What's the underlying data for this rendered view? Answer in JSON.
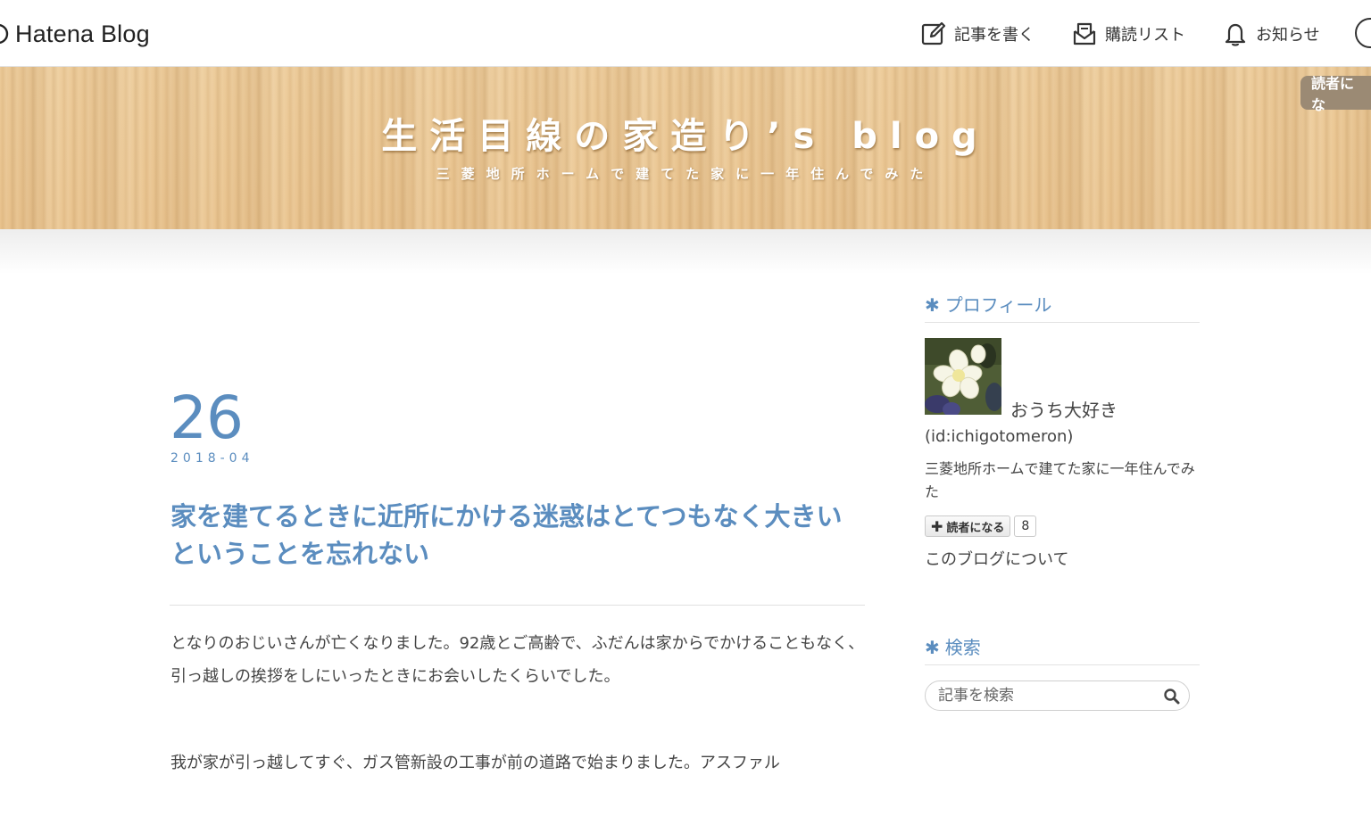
{
  "topbar": {
    "brand": "Hatena Blog",
    "nav": [
      {
        "label": "記事を書く",
        "icon": "pencil-square-icon"
      },
      {
        "label": "購読リスト",
        "icon": "mail-tray-icon"
      },
      {
        "label": "お知らせ",
        "icon": "bell-icon"
      }
    ],
    "avatar_icon": "user-avatar-icon"
  },
  "header": {
    "title": "生活目線の家造り’s blog",
    "description": "三菱地所ホームで建てた家に一年住んでみた",
    "reader_button": "読者にな"
  },
  "entry": {
    "day": "26",
    "year_month": "2018-04",
    "title": "家を建てるときに近所にかける迷惑はとてつもなく大きいということを忘れない",
    "paragraphs": [
      "となりのおじいさんが亡くなりました。92歳とご高齢で、ふだんは家からでかけることもなく、引っ越しの挨拶をしにいったときにお会いしたくらいでした。",
      "我が家が引っ越してすぐ、ガス管新設の工事が前の道路で始まりました。アスファル"
    ]
  },
  "sidebar": {
    "profile_heading": "プロフィール",
    "nickname": "おうち大好き",
    "user_id": "(id:ichigotomeron)",
    "description": "三菱地所ホームで建てた家に一年住んでみた",
    "subscribe_label": "読者になる",
    "subscriber_count": "8",
    "about_link": "このブログについて",
    "search_heading": "検索",
    "search_placeholder": "記事を検索"
  },
  "colors": {
    "accent": "#5b8dbf",
    "banner_wood": "#ecca98",
    "reader_button": "#9b8a74"
  }
}
